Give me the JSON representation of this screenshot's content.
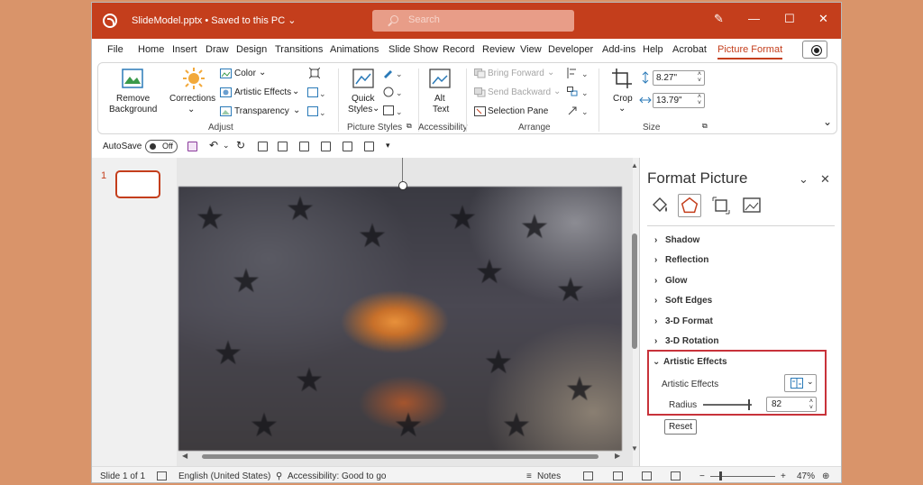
{
  "titlebar": {
    "filename": "SlideModel.pptx",
    "saved": "Saved to this PC",
    "search_placeholder": "Search",
    "minimize": "—",
    "maximize": "☐",
    "close": "✕",
    "pen": "✎",
    "accent": "#C43E1C"
  },
  "tabs": [
    "File",
    "Home",
    "Insert",
    "Draw",
    "Design",
    "Transitions",
    "Animations",
    "Slide Show",
    "Record",
    "Review",
    "View",
    "Developer",
    "Add-ins",
    "Help",
    "Acrobat",
    "Picture Format"
  ],
  "ribbon": {
    "remove_bg": [
      "Remove",
      "Background"
    ],
    "corrections": "Corrections",
    "color": "Color",
    "artistic": "Artistic Effects",
    "transparency": "Transparency",
    "adjust": "Adjust",
    "quick_styles": [
      "Quick",
      "Styles"
    ],
    "picture_styles": "Picture Styles",
    "alt_text": [
      "Alt",
      "Text"
    ],
    "accessibility": "Accessibility",
    "bring_forward": "Bring Forward",
    "send_backward": "Send Backward",
    "selection_pane": "Selection Pane",
    "arrange": "Arrange",
    "crop": "Crop",
    "height": "8.27\"",
    "width": "13.79\"",
    "size": "Size"
  },
  "qat": {
    "autosave": "AutoSave",
    "toggle": "Off"
  },
  "slides": {
    "number": "1"
  },
  "panel": {
    "title": "Format Picture",
    "sections": [
      "Shadow",
      "Reflection",
      "Glow",
      "Soft Edges",
      "3-D Format",
      "3-D Rotation",
      "Artistic Effects"
    ],
    "artistic_label": "Artistic Effects",
    "radius_label": "Radius",
    "radius_value": "82",
    "reset": "Reset"
  },
  "status": {
    "slide": "Slide 1 of 1",
    "language": "English (United States)",
    "accessibility": "Accessibility: Good to go",
    "notes": "Notes",
    "zoom": "47%"
  }
}
